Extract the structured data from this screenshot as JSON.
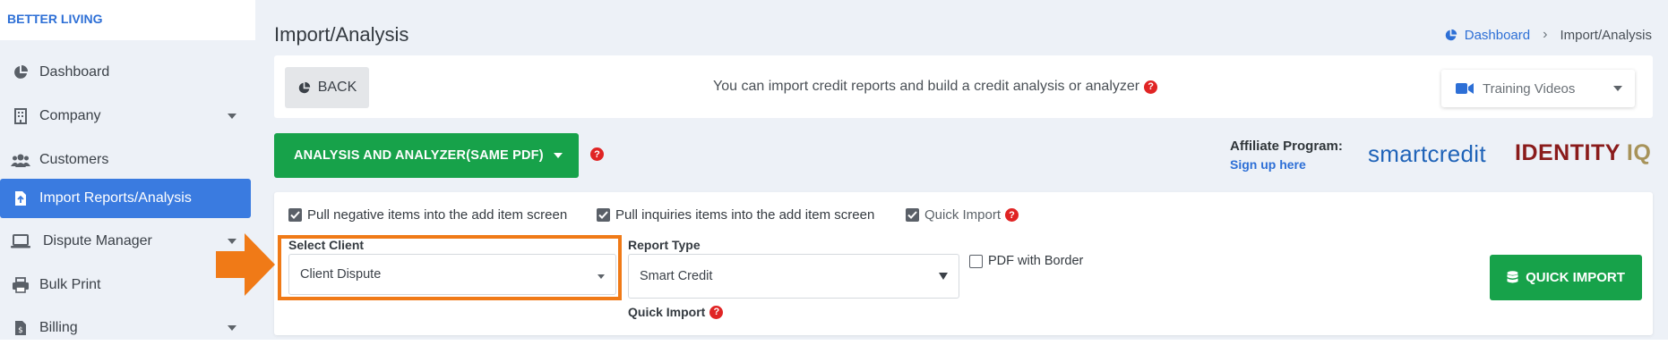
{
  "brand": "BETTER LIVING",
  "sidebar": {
    "items": [
      {
        "label": "Dashboard",
        "icon": "pie-chart-icon",
        "active": false,
        "has_caret": false
      },
      {
        "label": "Company",
        "icon": "building-icon",
        "active": false,
        "has_caret": true
      },
      {
        "label": "Customers",
        "icon": "users-icon",
        "active": false,
        "has_caret": false
      },
      {
        "label": "Import Reports/Analysis",
        "icon": "file-import-icon",
        "active": true,
        "has_caret": false
      },
      {
        "label": "Dispute Manager",
        "icon": "laptop-icon",
        "active": false,
        "has_caret": true
      },
      {
        "label": "Bulk Print",
        "icon": "printer-icon",
        "active": false,
        "has_caret": false
      },
      {
        "label": "Billing",
        "icon": "invoice-icon",
        "active": false,
        "has_caret": true
      }
    ]
  },
  "header": {
    "title": "Import/Analysis",
    "breadcrumb": {
      "home": "Dashboard",
      "separator": "›",
      "current": "Import/Analysis"
    }
  },
  "topbar": {
    "back_label": "BACK",
    "message": "You can import credit reports and build a credit analysis or analyzer",
    "help_glyph": "?",
    "training_label": "Training Videos"
  },
  "analysis": {
    "button_label": "ANALYSIS AND ANALYZER(SAME PDF)",
    "help_glyph": "?"
  },
  "affiliate": {
    "label": "Affiliate Program:",
    "link": "Sign up here",
    "partner1": "smartcredit",
    "partner2_a": "IDENTITY",
    "partner2_b": " IQ"
  },
  "import": {
    "checkboxes": [
      {
        "label": "Pull negative items into the add item screen",
        "checked": true
      },
      {
        "label": "Pull inquiries items into the add item screen",
        "checked": true
      },
      {
        "label": "Quick Import",
        "checked": true
      }
    ],
    "select_client_label": "Select Client",
    "select_client_value": "Client Dispute",
    "report_type_label": "Report Type",
    "report_type_value": "Smart Credit",
    "pdf_border_label": "PDF with Border",
    "pdf_border_checked": false,
    "quick_import_label": "Quick Import",
    "quick_import_button": "QUICK IMPORT"
  },
  "colors": {
    "accent_blue": "#3a7be0",
    "green": "#17a24a",
    "highlight_orange": "#f07a17",
    "help_red": "#e02424"
  }
}
